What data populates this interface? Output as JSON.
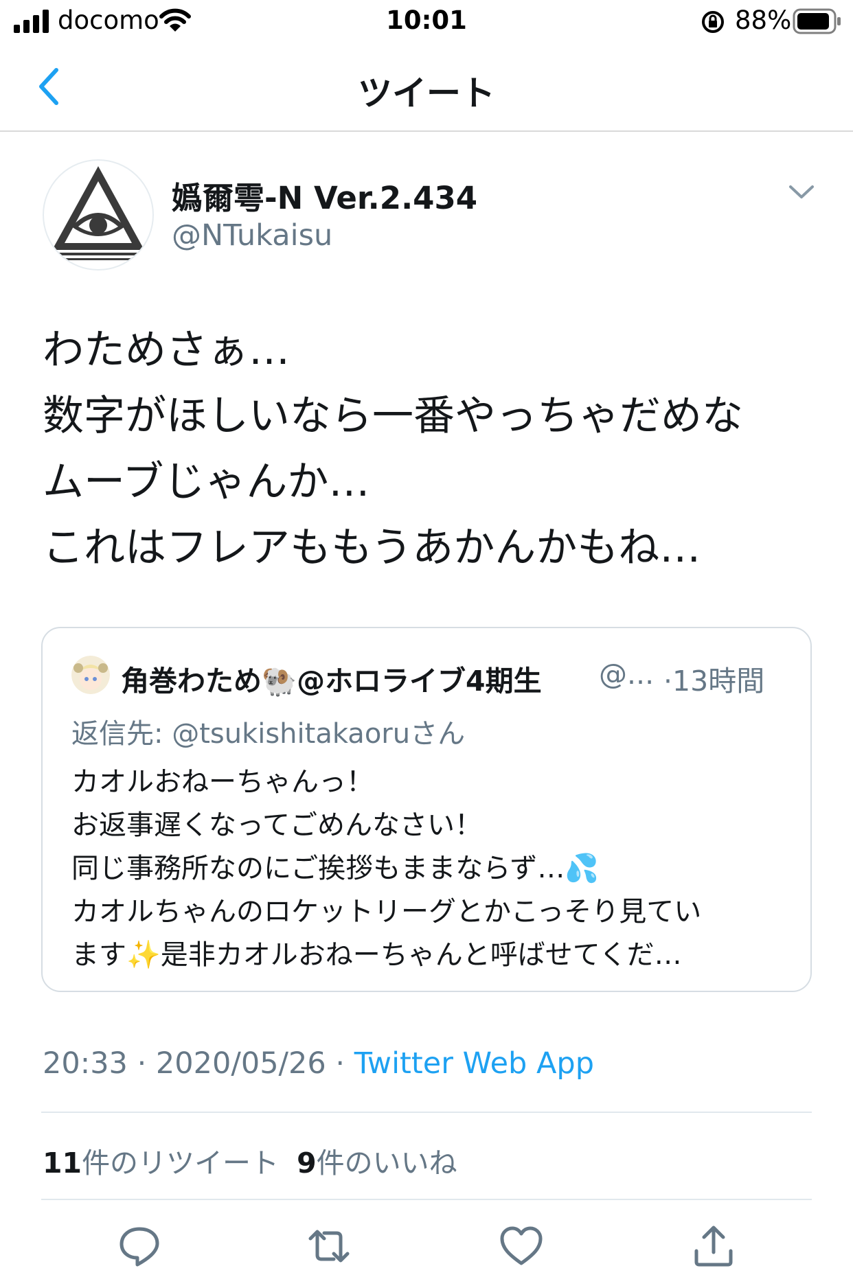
{
  "status_bar": {
    "carrier": "docomo",
    "time": "10:01",
    "battery_percent": "88%"
  },
  "nav": {
    "title": "ツイート",
    "back_icon": "chevron-left-icon"
  },
  "tweet": {
    "author_name": "嬀爾雩-N Ver.2.434",
    "author_handle": "@NTukaisu",
    "body_lines": [
      "わためさぁ…",
      "数字がほしいなら一番やっちゃだめな",
      "ムーブじゃんか…",
      "これはフレアももうあかんかもね…"
    ],
    "timestamp": "20:33 · 2020/05/26 · ",
    "source": "Twitter Web App",
    "retweets_count": "11",
    "retweets_label": "件のリツイート",
    "likes_count": "9",
    "likes_label": "件のいいね"
  },
  "quoted_tweet": {
    "name": "角巻わため",
    "name_emoji": "🐏",
    "name_suffix": "@ホロライブ4期生",
    "handle": "@...",
    "time": "·13時間",
    "reply_to": "返信先: @tsukishitakaoruさん",
    "lines": [
      "カオルおねーちゃんっ！",
      "お返事遅くなってごめんなさい！",
      "同じ事務所なのにご挨拶もままならず…💦",
      "カオルちゃんのロケットリーグとかこっそり見てい",
      "ます✨是非カオルおねーちゃんと呼ばせてくだ…"
    ]
  },
  "actions": [
    "reply-icon",
    "retweet-icon",
    "like-icon",
    "share-icon"
  ],
  "colors": {
    "accent": "#1da1f2",
    "secondary_text": "#657786",
    "divider": "#e1e8ed"
  }
}
